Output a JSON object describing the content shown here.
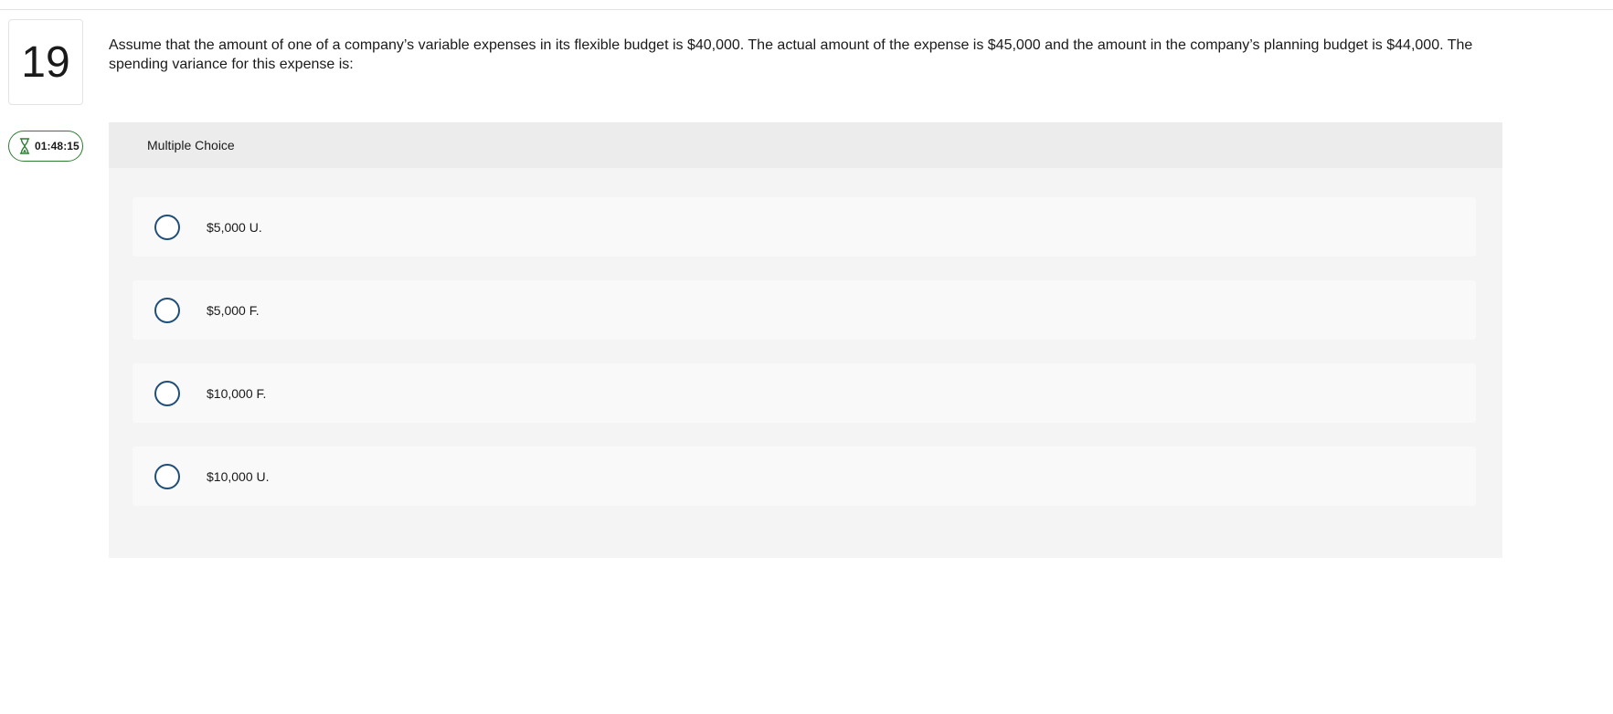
{
  "question": {
    "number": "19",
    "timer": "01:48:15",
    "timer_icon": "hourglass-icon",
    "text": "Assume that the amount of one of a company’s variable expenses in its flexible budget is $40,000. The actual amount of the expense is $45,000 and the amount in the company’s planning budget is $44,000. The spending variance for this expense is:"
  },
  "answer_panel": {
    "type_label": "Multiple Choice",
    "options": [
      {
        "label": "$5,000 U."
      },
      {
        "label": "$5,000 F."
      },
      {
        "label": "$10,000 F."
      },
      {
        "label": "$10,000 U."
      }
    ]
  },
  "colors": {
    "timer_border": "#2e7d32",
    "radio_border": "#1f4e79",
    "panel_bg": "#f4f4f4",
    "panel_header_bg": "#ececec"
  }
}
